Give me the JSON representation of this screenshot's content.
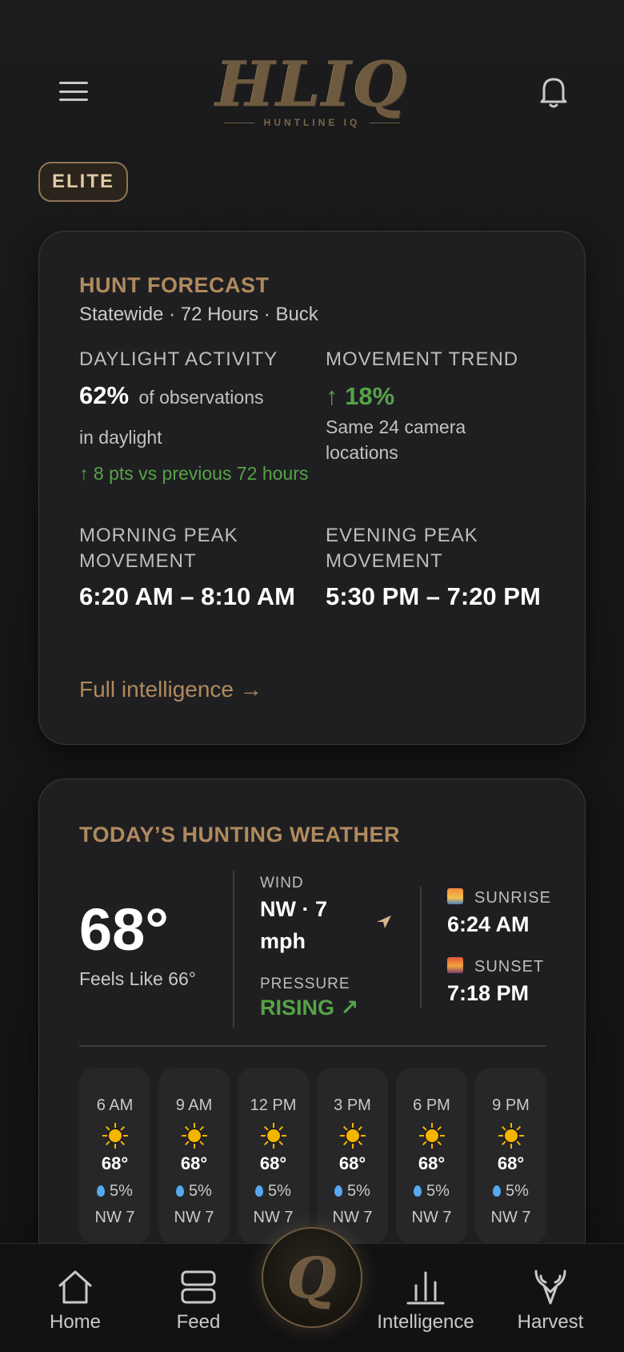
{
  "header": {
    "logo_mark": "HLIQ",
    "logo_sub": "HUNTLINE IQ",
    "menu_icon": "hamburger-icon",
    "bell_icon": "bell-icon"
  },
  "badge": {
    "label": "ELITE"
  },
  "forecast": {
    "title": "HUNT FORECAST",
    "subtitle": "Statewide · 72 Hours · Buck",
    "daylight_label": "DAYLIGHT ACTIVITY",
    "daylight_value": "62%",
    "daylight_suffix": "of observations",
    "daylight_suffix2": "in daylight",
    "daylight_change": "↑ 8 pts vs previous 72 hours",
    "trend_label": "MOVEMENT TREND",
    "trend_value": "↑ 18%",
    "trend_note": "Same 24 camera locations",
    "morning_label": "MORNING PEAK MOVEMENT",
    "morning_value": "6:20 AM – 8:10 AM",
    "evening_label": "EVENING PEAK MOVEMENT",
    "evening_value": "5:30 PM – 7:20 PM",
    "link": "Full intelligence →"
  },
  "weather": {
    "title": "TODAY’S HUNTING WEATHER",
    "temp": "68°",
    "feels_like": "Feels Like 66°",
    "wind_label": "WIND",
    "wind_value": "NW · 7 mph",
    "pressure_label": "PRESSURE",
    "pressure_value": "RISING ↗",
    "sunrise_label": "SUNRISE",
    "sunrise_value": "6:24 AM",
    "sunset_label": "SUNSET",
    "sunset_value": "7:18 PM",
    "hourly": [
      {
        "time": "6 AM",
        "temp": "68°",
        "rain": "5%",
        "wind": "NW 7"
      },
      {
        "time": "9 AM",
        "temp": "68°",
        "rain": "5%",
        "wind": "NW 7"
      },
      {
        "time": "12 PM",
        "temp": "68°",
        "rain": "5%",
        "wind": "NW 7"
      },
      {
        "time": "3 PM",
        "temp": "68°",
        "rain": "5%",
        "wind": "NW 7"
      },
      {
        "time": "6 PM",
        "temp": "68°",
        "rain": "5%",
        "wind": "NW 7"
      },
      {
        "time": "9 PM",
        "temp": "68°",
        "rain": "5%",
        "wind": "NW 7"
      }
    ]
  },
  "tabs": {
    "home": "Home",
    "feed": "Feed",
    "center": "Q",
    "intelligence": "Intelligence",
    "harvest": "Harvest"
  },
  "colors": {
    "accent": "#b08a5e",
    "positive": "#57a248",
    "card": "#1f1f21"
  }
}
